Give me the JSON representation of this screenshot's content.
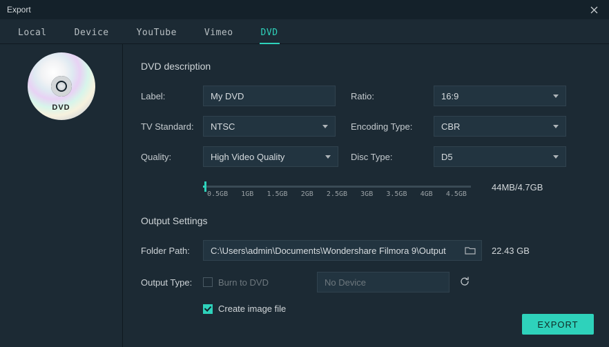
{
  "window": {
    "title": "Export"
  },
  "tabs": {
    "local": "Local",
    "device": "Device",
    "youtube": "YouTube",
    "vimeo": "Vimeo",
    "dvd": "DVD"
  },
  "dvd": {
    "disc_label": "DVD",
    "section1_title": "DVD description",
    "label_lbl": "Label:",
    "label_val": "My DVD",
    "ratio_lbl": "Ratio:",
    "ratio_val": "16:9",
    "tvstd_lbl": "TV Standard:",
    "tvstd_val": "NTSC",
    "enc_lbl": "Encoding Type:",
    "enc_val": "CBR",
    "quality_lbl": "Quality:",
    "quality_val": "High Video Quality",
    "disctype_lbl": "Disc Type:",
    "disctype_val": "D5",
    "slider_ticks": [
      "0.5GB",
      "1GB",
      "1.5GB",
      "2GB",
      "2.5GB",
      "3GB",
      "3.5GB",
      "4GB",
      "4.5GB"
    ],
    "size_text": "44MB/4.7GB",
    "section2_title": "Output Settings",
    "folder_lbl": "Folder Path:",
    "folder_val": "C:\\Users\\admin\\Documents\\Wondershare Filmora 9\\Output",
    "free_space": "22.43 GB",
    "output_type_lbl": "Output Type:",
    "burn_label": "Burn to DVD",
    "device_val": "No Device",
    "create_img_label": "Create image file",
    "export_btn": "EXPORT"
  }
}
